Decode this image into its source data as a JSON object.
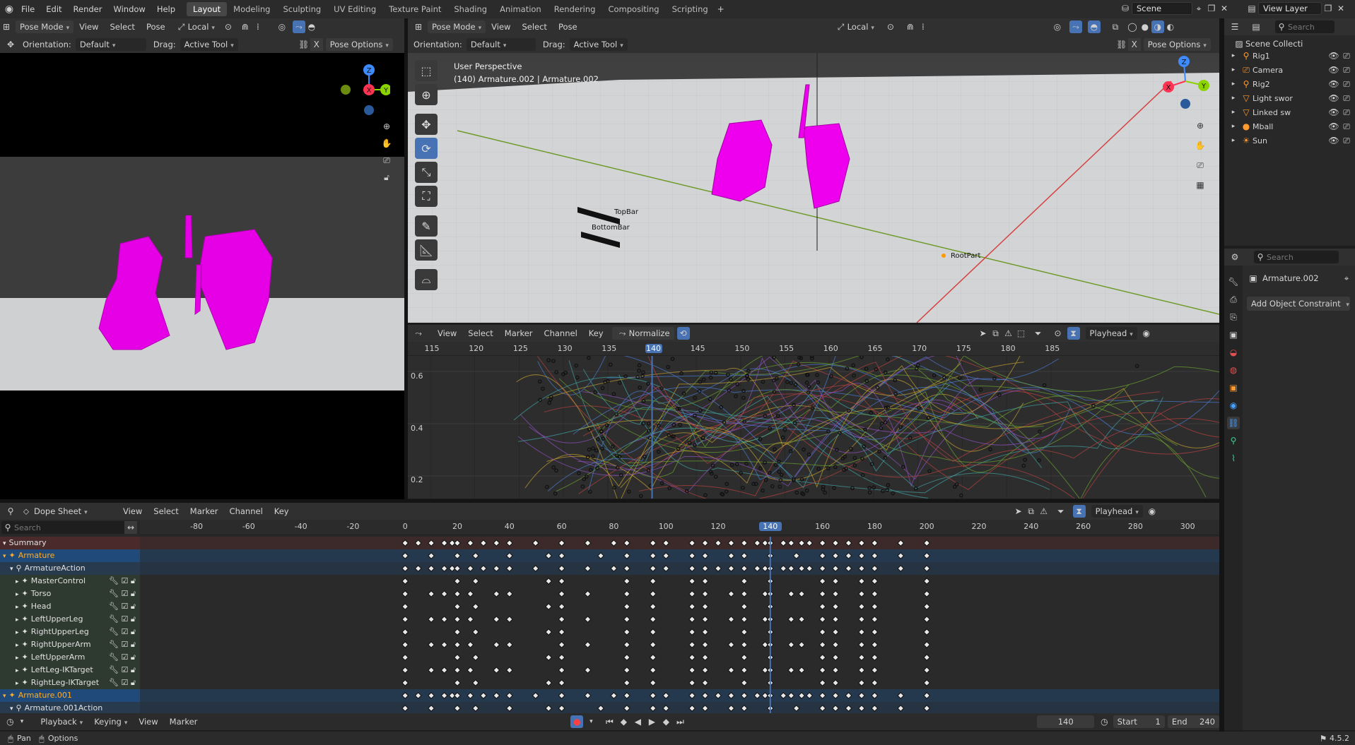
{
  "topbar": {
    "menus": [
      "File",
      "Edit",
      "Render",
      "Window",
      "Help"
    ],
    "workspaces": [
      "Layout",
      "Modeling",
      "Sculpting",
      "UV Editing",
      "Texture Paint",
      "Shading",
      "Animation",
      "Rendering",
      "Compositing",
      "Scripting"
    ],
    "active_workspace": "Layout",
    "scene": "Scene",
    "view_layer": "View Layer"
  },
  "left_view": {
    "mode": "Pose Mode",
    "menus": [
      "View",
      "Select",
      "Pose"
    ],
    "orientation_space": "Local",
    "orientation_label": "Orientation:",
    "orientation_value": "Default",
    "drag_label": "Drag:",
    "drag_value": "Active Tool",
    "pose_options": "Pose Options",
    "gizmo": {
      "z": "Z",
      "x": "X",
      "y": "Y"
    }
  },
  "main_view": {
    "mode": "Pose Mode",
    "menus": [
      "View",
      "Select",
      "Pose"
    ],
    "orientation_space": "Local",
    "orientation_label": "Orientation:",
    "orientation_value": "Default",
    "drag_label": "Drag:",
    "drag_value": "Active Tool",
    "pose_options": "Pose Options",
    "perspective": "User Perspective",
    "object_info": "(140) Armature.002 | Armature.002",
    "scene_labels": {
      "topbar": "TopBar",
      "bottombar": "BottomBar",
      "rootpart": "RootPart"
    },
    "gizmo": {
      "z": "Z",
      "x": "X",
      "y": "Y"
    }
  },
  "graph_editor": {
    "menus": [
      "View",
      "Select",
      "Marker",
      "Channel",
      "Key"
    ],
    "normalize": "Normalize",
    "playhead": "Playhead",
    "frame_ticks": [
      "115",
      "120",
      "125",
      "130",
      "135",
      "140",
      "145",
      "150",
      "155",
      "160",
      "165",
      "170",
      "175",
      "180",
      "185"
    ],
    "current_frame": "140",
    "y_ticks": [
      "0.6",
      "0.4",
      "0.2"
    ]
  },
  "dope_sheet": {
    "editor_mode": "Dope Sheet",
    "menus": [
      "View",
      "Select",
      "Marker",
      "Channel",
      "Key"
    ],
    "search_placeholder": "Search",
    "playhead": "Playhead",
    "frame_ticks": [
      "-80",
      "-60",
      "-40",
      "-20",
      "0",
      "20",
      "40",
      "60",
      "80",
      "100",
      "120",
      "140",
      "160",
      "180",
      "200",
      "220",
      "240",
      "260",
      "280",
      "300"
    ],
    "current_frame": "140",
    "channels": [
      {
        "label": "Summary",
        "kind": "summary"
      },
      {
        "label": "Armature",
        "kind": "object"
      },
      {
        "label": "ArmatureAction",
        "kind": "action"
      },
      {
        "label": "MasterControl",
        "kind": "bone"
      },
      {
        "label": "Torso",
        "kind": "bone"
      },
      {
        "label": "Head",
        "kind": "bone"
      },
      {
        "label": "LeftUpperLeg",
        "kind": "bone"
      },
      {
        "label": "RightUpperLeg",
        "kind": "bone"
      },
      {
        "label": "RightUpperArm",
        "kind": "bone"
      },
      {
        "label": "LeftUpperArm",
        "kind": "bone"
      },
      {
        "label": "LeftLeg-IKTarget",
        "kind": "bone"
      },
      {
        "label": "RightLeg-IKTarget",
        "kind": "bone"
      },
      {
        "label": "Armature.001",
        "kind": "object"
      },
      {
        "label": "Armature.001Action",
        "kind": "action"
      }
    ]
  },
  "timeline": {
    "menus": [
      "Playback",
      "Keying",
      "View",
      "Marker"
    ],
    "current_frame": "140",
    "start_label": "Start",
    "start": "1",
    "end_label": "End",
    "end": "240"
  },
  "outliner": {
    "search_placeholder": "Search",
    "root": "Scene Collecti",
    "items": [
      {
        "name": "Rig1",
        "icon": "armature-icon"
      },
      {
        "name": "Camera",
        "icon": "camera-icon"
      },
      {
        "name": "Rig2",
        "icon": "armature-icon"
      },
      {
        "name": "Light swor",
        "icon": "mesh-icon"
      },
      {
        "name": "Linked sw",
        "icon": "mesh-icon"
      },
      {
        "name": "Mball",
        "icon": "metaball-icon"
      },
      {
        "name": "Sun",
        "icon": "light-icon"
      }
    ]
  },
  "properties": {
    "search_placeholder": "Search",
    "object_name": "Armature.002",
    "add_constraint": "Add Object Constraint"
  },
  "statusbar": {
    "pan": "Pan",
    "options": "Options",
    "version": "4.5.2"
  },
  "colors": {
    "accent": "#4772b3",
    "active_object": "#ffaf29",
    "magenta": "#ee00ee",
    "selected_row": "#1f4a7a"
  }
}
